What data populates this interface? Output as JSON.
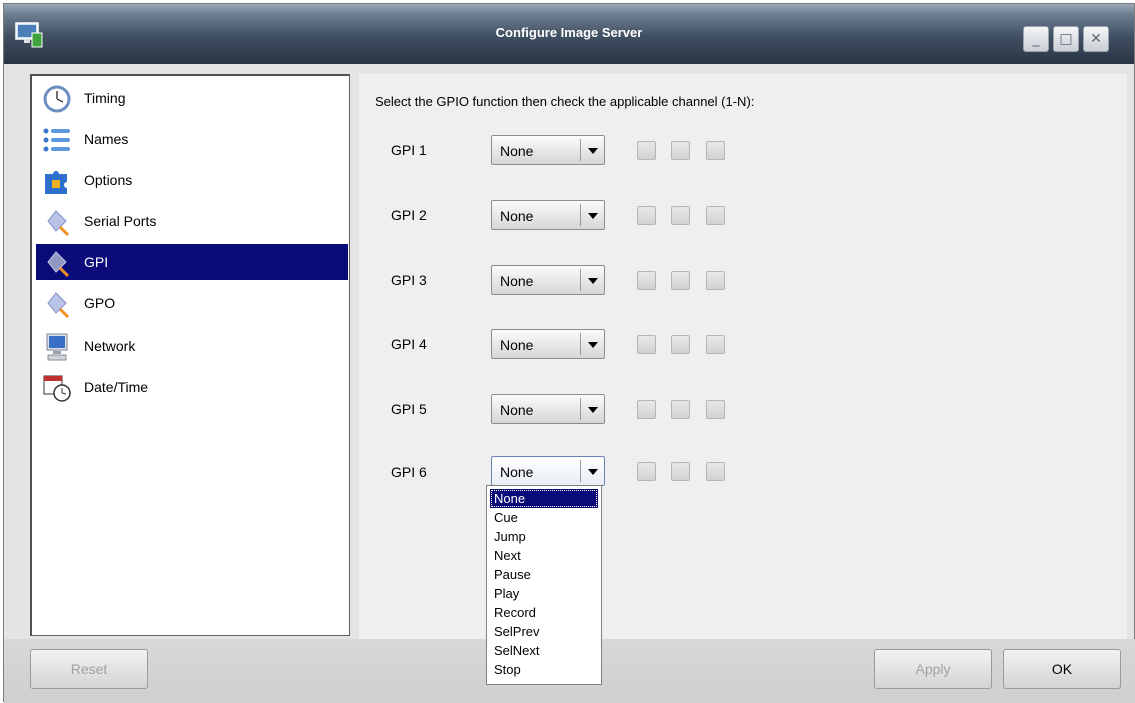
{
  "window": {
    "title": "Configure Image Server",
    "controls": {
      "minimize": "_",
      "maximize": "□",
      "close": "✕"
    }
  },
  "sidebar": {
    "selected_index": 4,
    "items": [
      {
        "label": "Timing",
        "icon": "clock-icon"
      },
      {
        "label": "Names",
        "icon": "list-icon"
      },
      {
        "label": "Options",
        "icon": "puzzle-icon"
      },
      {
        "label": "Serial Ports",
        "icon": "plug-icon"
      },
      {
        "label": "GPI",
        "icon": "plug-icon"
      },
      {
        "label": "GPO",
        "icon": "plug-icon"
      },
      {
        "label": "Network",
        "icon": "computer-icon"
      },
      {
        "label": "Date/Time",
        "icon": "calendar-clock-icon"
      }
    ]
  },
  "main": {
    "instruction": "Select the GPIO function then check the applicable channel (1-N):",
    "gpis": [
      {
        "label": "GPI 1",
        "function": "None",
        "channels": [
          false,
          false,
          false
        ]
      },
      {
        "label": "GPI 2",
        "function": "None",
        "channels": [
          false,
          false,
          false
        ]
      },
      {
        "label": "GPI 3",
        "function": "None",
        "channels": [
          false,
          false,
          false
        ]
      },
      {
        "label": "GPI 4",
        "function": "None",
        "channels": [
          false,
          false,
          false
        ]
      },
      {
        "label": "GPI 5",
        "function": "None",
        "channels": [
          false,
          false,
          false
        ]
      },
      {
        "label": "GPI 6",
        "function": "None",
        "channels": [
          false,
          false,
          false
        ]
      }
    ],
    "open_dropdown": {
      "for": "GPI 6",
      "selected": "None",
      "options": [
        "None",
        "Cue",
        "Jump",
        "Next",
        "Pause",
        "Play",
        "Record",
        "SelPrev",
        "SelNext",
        "Stop"
      ]
    }
  },
  "footer": {
    "reset_label": "Reset",
    "apply_label": "Apply",
    "ok_label": "OK"
  },
  "colors": {
    "selection": "#0a0a78",
    "titlebar": "#3f4e61",
    "panel": "#f0eff0"
  }
}
